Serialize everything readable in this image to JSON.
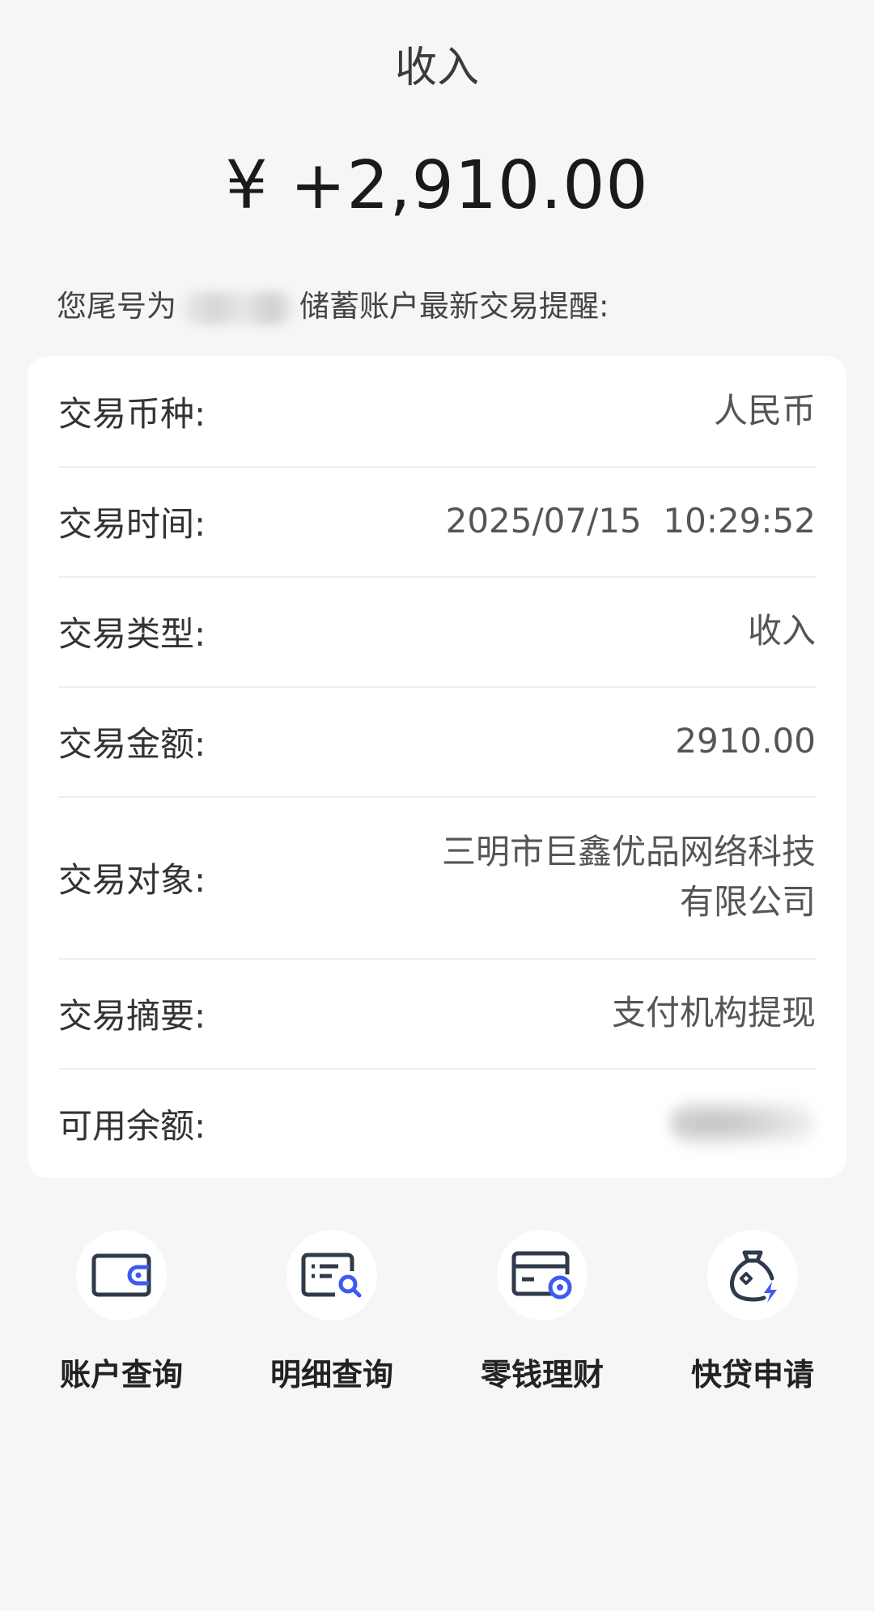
{
  "header": {
    "label": "收入",
    "amount": "¥ +2,910.00"
  },
  "notice": {
    "prefix": "您尾号为",
    "suffix": "储蓄账户最新交易提醒:"
  },
  "details": {
    "currency": {
      "label": "交易币种:",
      "value": "人民币"
    },
    "time": {
      "label": "交易时间:",
      "value": "2025/07/15  10:29:52"
    },
    "type": {
      "label": "交易类型:",
      "value": "收入"
    },
    "amount": {
      "label": "交易金额:",
      "value": "2910.00"
    },
    "counterparty": {
      "label": "交易对象:",
      "value_line1": "三明市巨鑫优品网络科技",
      "value_line2": "有限公司"
    },
    "summary": {
      "label": "交易摘要:",
      "value": "支付机构提现"
    },
    "balance": {
      "label": "可用余额:"
    }
  },
  "actions": {
    "account_query": "账户查询",
    "detail_query": "明细查询",
    "wealth": "零钱理财",
    "loan": "快贷申请"
  },
  "colors": {
    "icon_dark": "#2f3a4a",
    "icon_blue": "#3d5af1",
    "background": "#f6f6f6"
  }
}
